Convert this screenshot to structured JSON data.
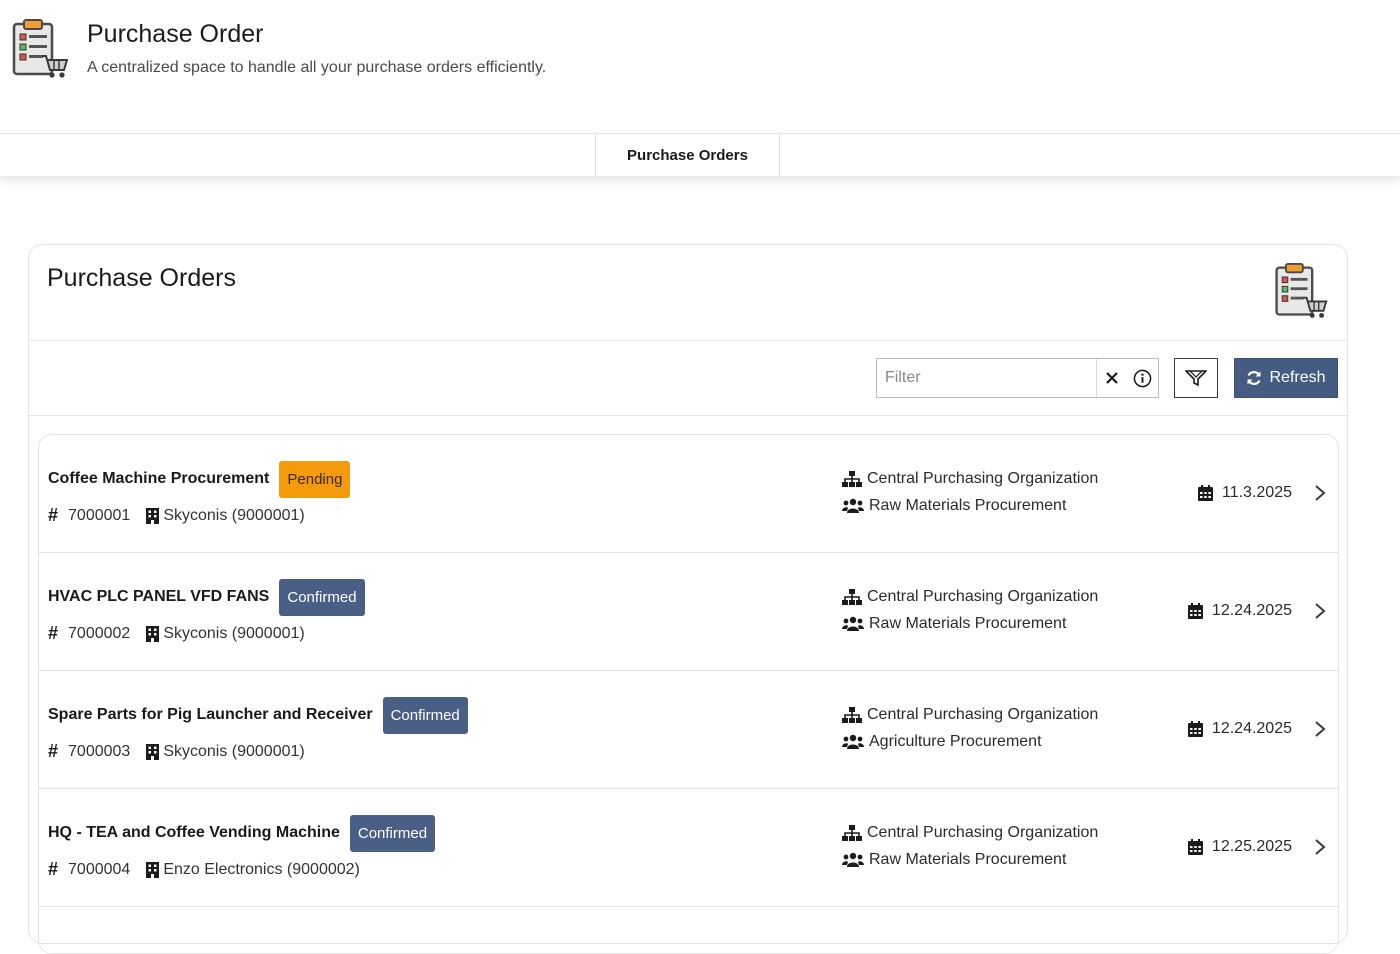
{
  "header": {
    "title": "Purchase Order",
    "subtitle": "A centralized space to handle all your purchase orders efficiently."
  },
  "tabs": [
    {
      "label": "Purchase Orders",
      "active": true
    }
  ],
  "panel": {
    "title": "Purchase Orders"
  },
  "toolbar": {
    "filter_placeholder": "Filter",
    "filter_value": "",
    "refresh_label": "Refresh"
  },
  "colors": {
    "accent": "#445b82",
    "pending": "#f59a0b",
    "confirmed": "#4a5f85"
  },
  "icons": {
    "app_logo": "clipboard-cart-icon",
    "org": "sitemap-icon",
    "group": "users-icon",
    "vendor": "building-icon",
    "date": "calendar-icon",
    "chevron": "chevron-right-icon",
    "clear": "close-icon",
    "info": "info-icon",
    "filter": "filter-icon",
    "refresh": "refresh-icon"
  },
  "orders": [
    {
      "title": "Coffee Machine Procurement",
      "status": "Pending",
      "number": "7000001",
      "vendor": "Skyconis (9000001)",
      "org": "Central Purchasing Organization",
      "group": "Raw Materials Procurement",
      "date": "11.3.2025"
    },
    {
      "title": "HVAC PLC PANEL VFD FANS",
      "status": "Confirmed",
      "number": "7000002",
      "vendor": "Skyconis (9000001)",
      "org": "Central Purchasing Organization",
      "group": "Raw Materials Procurement",
      "date": "12.24.2025"
    },
    {
      "title": "Spare Parts for Pig Launcher and Receiver",
      "status": "Confirmed",
      "number": "7000003",
      "vendor": "Skyconis (9000001)",
      "org": "Central Purchasing Organization",
      "group": "Agriculture Procurement",
      "date": "12.24.2025"
    },
    {
      "title": "HQ - TEA and Coffee Vending Machine",
      "status": "Confirmed",
      "number": "7000004",
      "vendor": "Enzo Electronics (9000002)",
      "org": "Central Purchasing Organization",
      "group": "Raw Materials Procurement",
      "date": "12.25.2025"
    }
  ]
}
